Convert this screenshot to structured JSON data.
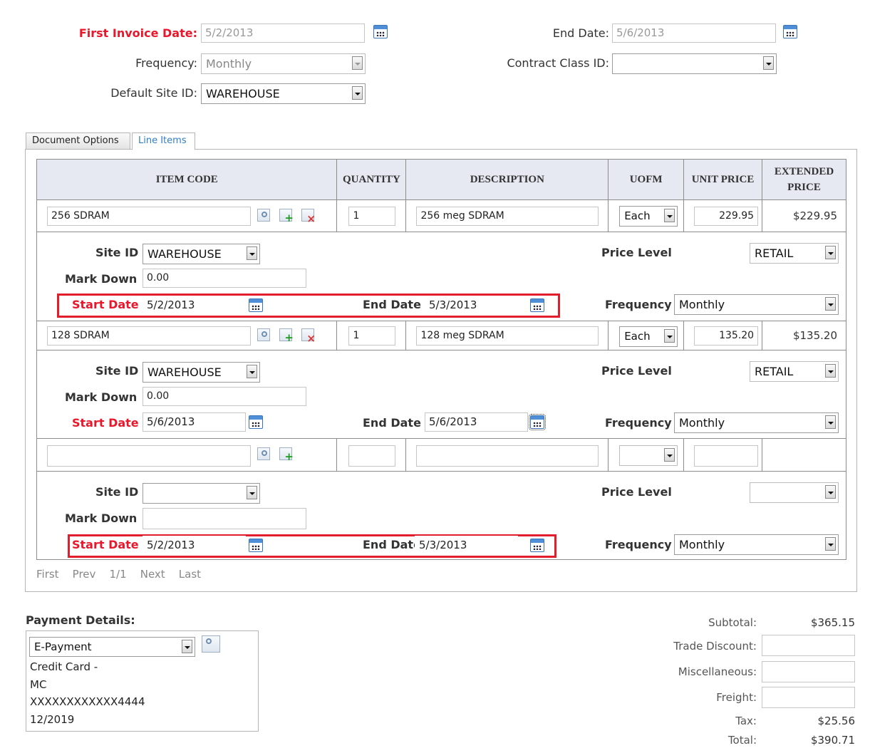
{
  "header": {
    "first_invoice_date_label": "First Invoice Date:",
    "first_invoice_date_value": "5/2/2013",
    "end_date_label": "End Date:",
    "end_date_value": "5/6/2013",
    "frequency_label": "Frequency:",
    "frequency_value": "Monthly",
    "contract_class_label": "Contract Class ID:",
    "contract_class_value": "",
    "default_site_label": "Default Site ID:",
    "default_site_value": "WAREHOUSE"
  },
  "tabs": [
    {
      "label": "Document Options",
      "active": false
    },
    {
      "label": "Line Items",
      "active": true
    }
  ],
  "grid": {
    "columns": [
      "ITEM CODE",
      "QUANTITY",
      "DESCRIPTION",
      "UOFM",
      "UNIT PRICE",
      "EXTENDED PRICE"
    ],
    "detail_labels": {
      "site_id": "Site ID",
      "mark_down": "Mark Down",
      "start_date": "Start Date",
      "end_date": "End Date",
      "price_level": "Price Level",
      "frequency": "Frequency"
    },
    "rows": [
      {
        "item_code": "256 SDRAM",
        "quantity": "1",
        "description": "256 meg SDRAM",
        "uofm": "Each",
        "unit_price": "229.95",
        "extended_price": "$229.95",
        "site_id": "WAREHOUSE",
        "mark_down": "0.00",
        "start_date": "5/2/2013",
        "end_date": "5/3/2013",
        "price_level": "RETAIL",
        "frequency": "Monthly"
      },
      {
        "item_code": "128 SDRAM",
        "quantity": "1",
        "description": "128 meg SDRAM",
        "uofm": "Each",
        "unit_price": "135.20",
        "extended_price": "$135.20",
        "site_id": "WAREHOUSE",
        "mark_down": "0.00",
        "start_date": "5/6/2013",
        "end_date": "5/6/2013",
        "price_level": "RETAIL",
        "frequency": "Monthly"
      },
      {
        "item_code": "",
        "quantity": "",
        "description": "",
        "uofm": "",
        "unit_price": "",
        "extended_price": "",
        "site_id": "",
        "mark_down": "",
        "start_date": "5/2/2013",
        "end_date": "5/3/2013",
        "price_level": "",
        "frequency": "Monthly"
      }
    ]
  },
  "pager": {
    "first": "First",
    "prev": "Prev",
    "page": "1/1",
    "next": "Next",
    "last": "Last"
  },
  "payment": {
    "label": "Payment Details:",
    "method": "E-Payment",
    "lines": [
      "Credit Card -",
      "MC",
      "XXXXXXXXXXXX4444",
      "12/2019"
    ]
  },
  "totals": {
    "subtotal_label": "Subtotal:",
    "subtotal_value": "$365.15",
    "trade_discount_label": "Trade Discount:",
    "trade_discount_value": "",
    "misc_label": "Miscellaneous:",
    "misc_value": "",
    "freight_label": "Freight:",
    "freight_value": "",
    "tax_label": "Tax:",
    "tax_value": "$25.56",
    "total_label": "Total:",
    "total_value": "$390.71"
  },
  "colors": {
    "required_label": "#e8172b",
    "highlight_box": "#e21d2c",
    "header_bg": "#e6e8f2"
  }
}
